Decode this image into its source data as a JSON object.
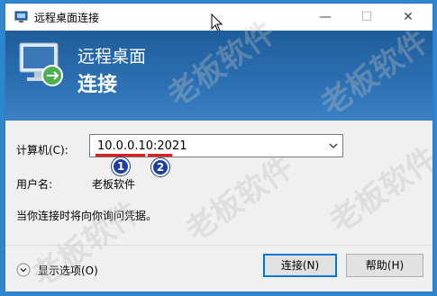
{
  "window": {
    "title": "远程桌面连接",
    "minimize_glyph": "—",
    "maximize_glyph": "☐",
    "close_glyph": "✕"
  },
  "banner": {
    "line1": "远程桌面",
    "line2": "连接"
  },
  "form": {
    "computer_label": "计算机(C):",
    "computer_value": "10.0.0.10:2021",
    "user_label": "用户名:",
    "user_value": "老板软件",
    "prompt_text": "当你连接时将向你询问凭据。"
  },
  "annotations": {
    "marker1": "1",
    "marker2": "2"
  },
  "footer": {
    "options_label": "显示选项(O)",
    "connect_label": "连接(N)",
    "help_label": "帮助(H)"
  },
  "watermark": {
    "text": "老板软件"
  },
  "colors": {
    "banner": "#2b6fb2",
    "accent": "#0078d7",
    "underline": "#e01e1e",
    "marker": "#1d3fa0"
  }
}
